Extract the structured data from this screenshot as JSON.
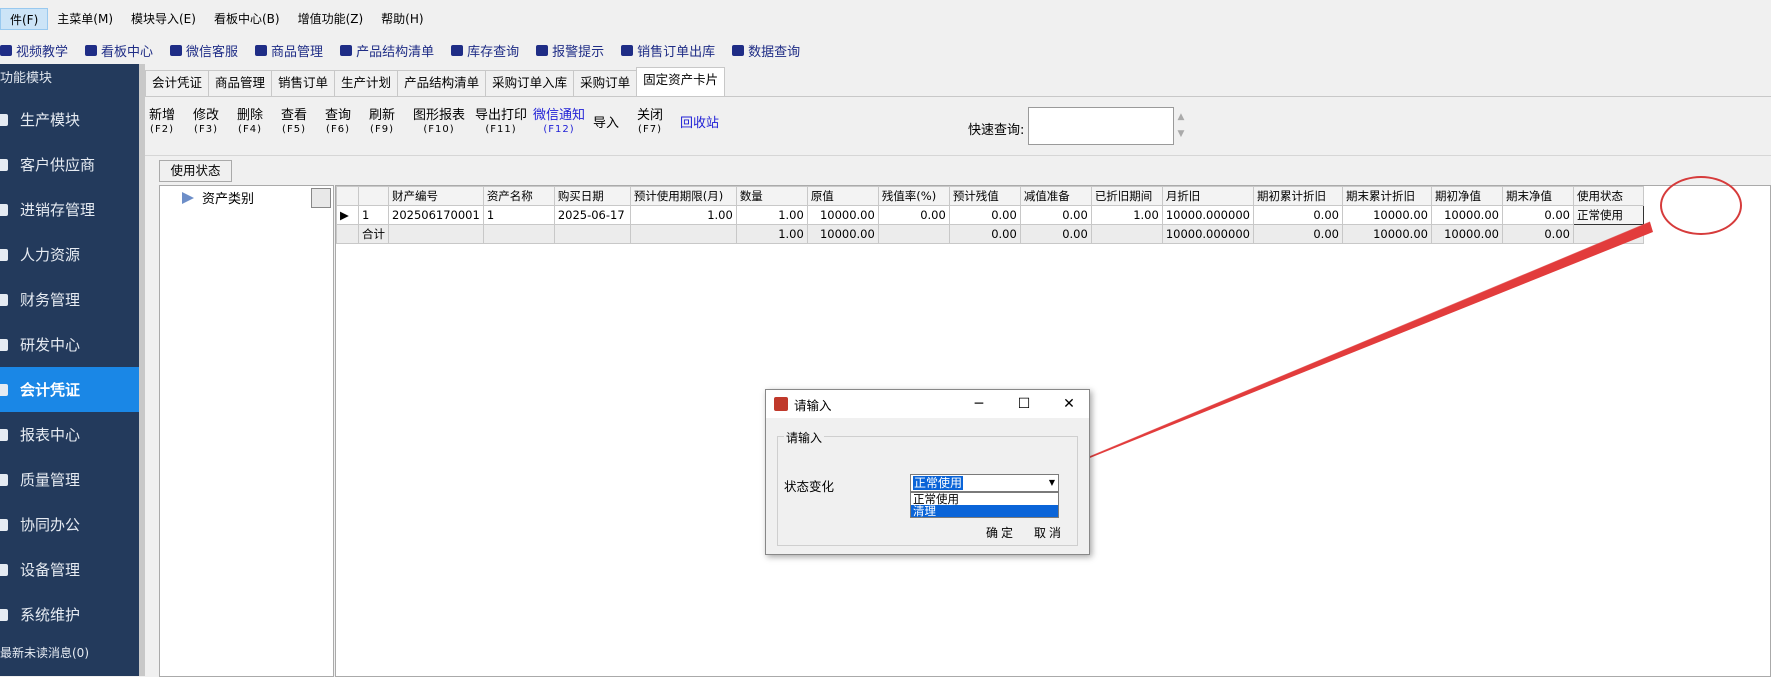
{
  "menubar": [
    {
      "label": "件(F)",
      "active": true
    },
    {
      "label": "主菜单(M)"
    },
    {
      "label": "模块导入(E)"
    },
    {
      "label": "看板中心(B)"
    },
    {
      "label": "增值功能(Z)"
    },
    {
      "label": "帮助(H)"
    }
  ],
  "quickbar": [
    {
      "label": "视频教学",
      "icon": "video-icon"
    },
    {
      "label": "看板中心",
      "icon": "dashboard-icon"
    },
    {
      "label": "微信客服",
      "icon": "person-icon"
    },
    {
      "label": "商品管理",
      "icon": "search-icon"
    },
    {
      "label": "产品结构清单",
      "icon": "camera-icon"
    },
    {
      "label": "库存查询",
      "icon": "org-icon"
    },
    {
      "label": "报警提示",
      "icon": "list-icon"
    },
    {
      "label": "销售订单出库",
      "icon": "list-icon"
    },
    {
      "label": "数据查询",
      "icon": "chat-icon"
    }
  ],
  "sidebar": {
    "title": "功能模块",
    "items": [
      {
        "label": "生产模块"
      },
      {
        "label": "客户供应商"
      },
      {
        "label": "进销存管理"
      },
      {
        "label": "人力资源"
      },
      {
        "label": "财务管理"
      },
      {
        "label": "研发中心"
      },
      {
        "label": "会计凭证",
        "active": true
      },
      {
        "label": "报表中心"
      },
      {
        "label": "质量管理"
      },
      {
        "label": "协同办公"
      },
      {
        "label": "设备管理"
      },
      {
        "label": "系统维护"
      }
    ],
    "message": "最新未读消息(0)"
  },
  "tabs": [
    {
      "label": "会计凭证"
    },
    {
      "label": "商品管理"
    },
    {
      "label": "销售订单"
    },
    {
      "label": "生产计划"
    },
    {
      "label": "产品结构清单"
    },
    {
      "label": "采购订单入库"
    },
    {
      "label": "采购订单"
    },
    {
      "label": "固定资产卡片",
      "active": true
    }
  ],
  "toolbar": [
    {
      "label": "新增",
      "key": "(F2)"
    },
    {
      "label": "修改",
      "key": "(F3)"
    },
    {
      "label": "删除",
      "key": "(F4)"
    },
    {
      "label": "查看",
      "key": "(F5)"
    },
    {
      "label": "查询",
      "key": "(F6)"
    },
    {
      "label": "刷新",
      "key": "(F9)"
    },
    {
      "label": "图形报表",
      "key": "(F10)"
    },
    {
      "label": "导出打印",
      "key": "(F11)"
    },
    {
      "label": "微信通知",
      "key": "(F12)",
      "color": "#1f1fd6"
    },
    {
      "label": "导入",
      "key": ""
    },
    {
      "label": "关闭",
      "key": "(F7)"
    },
    {
      "label": "回收站",
      "key": "",
      "color": "#1f1fd6"
    }
  ],
  "quick_search": {
    "label": "快速查询:",
    "value": ""
  },
  "filter": {
    "status_button": "使用状态"
  },
  "tree": {
    "root": "资产类别"
  },
  "grid": {
    "columns": [
      "",
      "",
      "财产编号",
      "资产名称",
      "购买日期",
      "预计使用期限(月)",
      "数量",
      "原值",
      "残值率(%)",
      "预计残值",
      "减值准备",
      "已折旧期间",
      "月折旧",
      "期初累计折旧",
      "期末累计折旧",
      "期初净值",
      "期末净值",
      "使用状态"
    ],
    "rows": [
      {
        "marker": "▶",
        "cells": [
          "1",
          "202506170001",
          "1",
          "2025-06-17",
          "1.00",
          "1.00",
          "10000.00",
          "0.00",
          "0.00",
          "0.00",
          "1.00",
          "10000.000000",
          "0.00",
          "10000.00",
          "10000.00",
          "0.00",
          "正常使用"
        ]
      }
    ],
    "summary": {
      "label": "合计",
      "cells": [
        "",
        "",
        "",
        "",
        "1.00",
        "10000.00",
        "",
        "0.00",
        "0.00",
        "",
        "10000.000000",
        "0.00",
        "10000.00",
        "10000.00",
        "0.00",
        ""
      ]
    }
  },
  "dialog": {
    "title": "请输入",
    "group_label": "请输入",
    "field_label": "状态变化",
    "selected": "正常使用",
    "options": [
      {
        "label": "正常使用"
      },
      {
        "label": "清理",
        "highlighted": true
      }
    ],
    "ok": "确定",
    "cancel": "取消"
  },
  "colors": {
    "sidebar_bg": "#233a5c",
    "sidebar_active": "#1a87e6",
    "annotation": "#d63b3b",
    "selection": "#0a64d8"
  }
}
